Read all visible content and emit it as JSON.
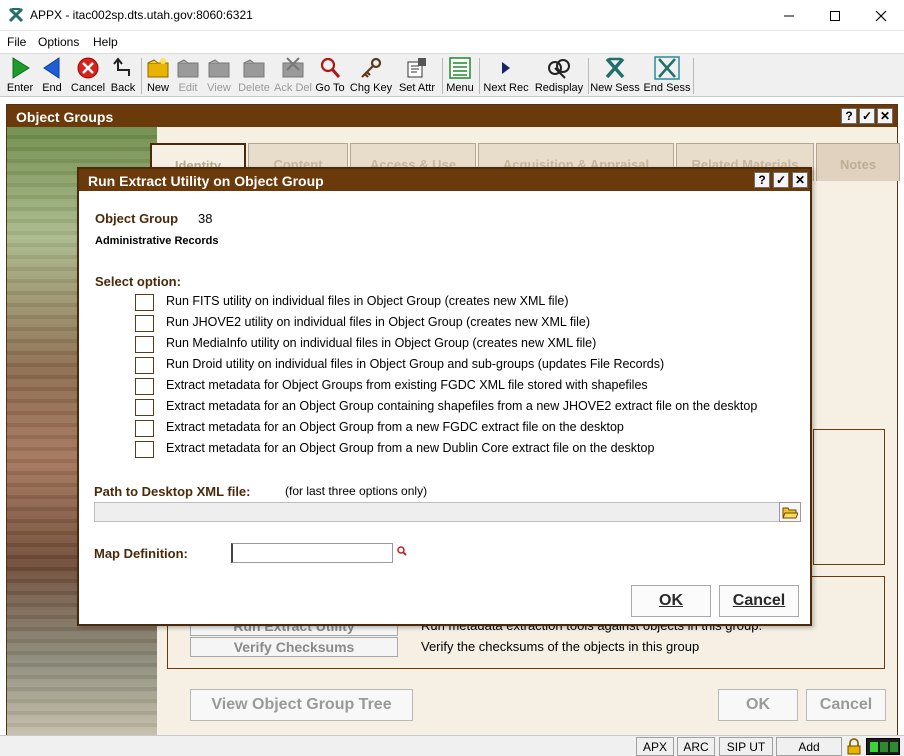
{
  "window": {
    "title": "APPX - itac002sp.dts.utah.gov:8060:6321",
    "controls": [
      "minimize",
      "maximize",
      "close"
    ]
  },
  "menu": {
    "items": [
      "File",
      "Options",
      "Help"
    ]
  },
  "toolbar": {
    "items": [
      {
        "label": "Enter",
        "icon": "enter-arrow-icon",
        "enabled": true
      },
      {
        "label": "End",
        "icon": "end-arrow-icon",
        "enabled": true
      },
      {
        "label": "Cancel",
        "icon": "cancel-x-icon",
        "enabled": true
      },
      {
        "label": "Back",
        "icon": "back-arrow-icon",
        "enabled": true
      },
      {
        "label": "New",
        "icon": "new-folder-icon",
        "enabled": true
      },
      {
        "label": "Edit",
        "icon": "edit-folder-icon",
        "enabled": false
      },
      {
        "label": "View",
        "icon": "view-folder-icon",
        "enabled": false
      },
      {
        "label": "Delete",
        "icon": "delete-folder-icon",
        "enabled": false
      },
      {
        "label": "Ack Del",
        "icon": "ack-delete-icon",
        "enabled": false
      },
      {
        "label": "Go To",
        "icon": "magnifier-icon",
        "enabled": true
      },
      {
        "label": "Chg Key",
        "icon": "key-icon",
        "enabled": true
      },
      {
        "label": "Set Attr",
        "icon": "set-attr-icon",
        "enabled": true
      },
      {
        "label": "Menu",
        "icon": "menu-list-icon",
        "enabled": true
      },
      {
        "label": "Next Rec",
        "icon": "next-record-icon",
        "enabled": true
      },
      {
        "label": "Redisplay",
        "icon": "redisplay-icon",
        "enabled": true
      },
      {
        "label": "New Sess",
        "icon": "new-session-icon",
        "enabled": true
      },
      {
        "label": "End Sess",
        "icon": "end-session-icon",
        "enabled": true
      }
    ]
  },
  "main": {
    "title": "Object Groups",
    "title_controls": [
      "?",
      "✓",
      "✕"
    ],
    "tabs": [
      {
        "label": "Identity",
        "active": true
      },
      {
        "label": "Content",
        "active": false
      },
      {
        "label": "Access & Use",
        "active": false
      },
      {
        "label": "Acquisition & Appraisal",
        "active": false
      },
      {
        "label": "Related Materials",
        "active": false
      },
      {
        "label": "Notes",
        "active": false
      }
    ],
    "actions": [
      {
        "button": "Run Extract Utility",
        "description": "Run metadata extraction tools against objects in this group."
      },
      {
        "button": "Verify Checksums",
        "description": "Verify the checksums of the objects in this group"
      }
    ],
    "bottom_buttons": {
      "tree": "View Object Group Tree",
      "ok": "OK",
      "cancel": "Cancel"
    }
  },
  "dialog": {
    "title": "Run Extract Utility on Object Group",
    "title_controls": [
      "?",
      "✓",
      "✕"
    ],
    "object_group_label": "Object Group",
    "object_group_value": "38",
    "object_group_name": "Administrative Records",
    "select_option_label": "Select option:",
    "options": [
      {
        "label": "Run FITS utility on individual files in Object Group (creates new XML file)",
        "checked": false
      },
      {
        "label": "Run JHOVE2 utility on individual files in Object Group (creates new XML file)",
        "checked": false
      },
      {
        "label": "Run MediaInfo utility on individual files in Object Group (creates new XML file)",
        "checked": false
      },
      {
        "label": "Run Droid utility on individual files in Object Group and sub-groups (updates File Records)",
        "checked": false
      },
      {
        "label": "Extract metadata for Object Groups from existing FGDC XML file stored with shapefiles",
        "checked": false
      },
      {
        "label": "Extract metadata for an Object Group containing shapefiles from a new JHOVE2 extract file on the desktop",
        "checked": false
      },
      {
        "label": "Extract metadata for an Object Group from a new FGDC extract file on the desktop",
        "checked": false
      },
      {
        "label": "Extract metadata for an Object Group from a new Dublin Core extract file on the desktop",
        "checked": false
      }
    ],
    "path_label": "Path to Desktop XML file:",
    "path_note": "(for last three options only)",
    "path_value": "",
    "map_label": "Map Definition:",
    "map_value": "",
    "ok": "OK",
    "cancel": "Cancel"
  },
  "statusbar": {
    "items": [
      "APX",
      "ARC",
      "SIP UT",
      "Add"
    ]
  },
  "colors": {
    "brand_brown": "#6b3a0b",
    "panel_bg": "#f6f0e4",
    "tab_bg": "#e8dccb"
  }
}
